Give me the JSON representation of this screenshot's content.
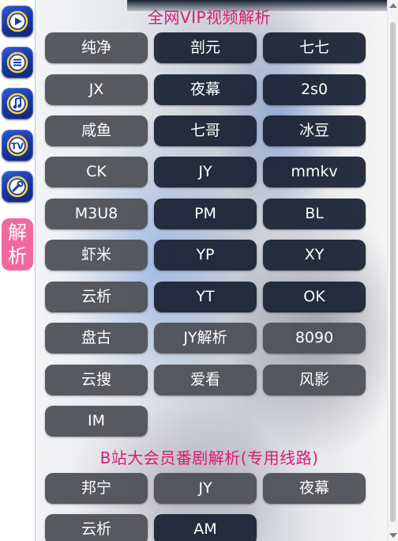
{
  "sidebar": {
    "icons": [
      "play-icon",
      "list-icon",
      "music-icon",
      "tv-icon",
      "wrench-icon"
    ],
    "active_tab": {
      "line1": "解",
      "line2": "析"
    }
  },
  "sections": [
    {
      "title": "全网VIP视频解析",
      "buttons": [
        "纯净",
        "剖元",
        "七七",
        "JX",
        "夜幕",
        "2s0",
        "咸鱼",
        "七哥",
        "冰豆",
        "CK",
        "JY",
        "mmkv",
        "M3U8",
        "PM",
        "BL",
        "虾米",
        "YP",
        "XY",
        "云析",
        "YT",
        "OK",
        "盘古",
        "JY解析",
        "8090",
        "云搜",
        "爱看",
        "风影",
        "IM"
      ]
    },
    {
      "title": "B站大会员番剧解析(专用线路)",
      "buttons": [
        "邦宁",
        "JY",
        "夜幕",
        "云析",
        "AM"
      ]
    }
  ],
  "colors": {
    "title": "#d81c74",
    "tab": "#f06aa0",
    "rail_icon": "#1a3aa8"
  }
}
